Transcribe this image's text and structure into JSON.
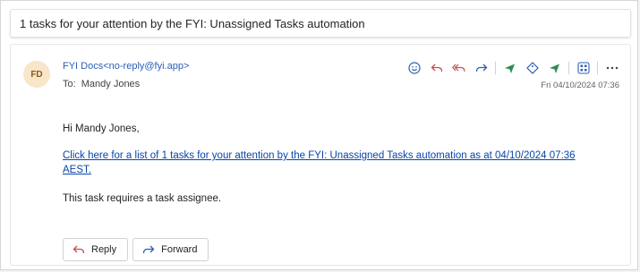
{
  "subject": "1 tasks for your attention by the FYI: Unassigned Tasks automation",
  "message": {
    "avatar_initials": "FD",
    "sender": "FYI Docs<no-reply@fyi.app>",
    "to_label": "To:",
    "to_name": "Mandy Jones",
    "date": "Fri 04/10/2024 07:36",
    "greeting": "Hi Mandy Jones,",
    "link_text": "Click here for a list of 1 tasks for your attention by the FYI: Unassigned Tasks automation as at 04/10/2024 07:36 AEST.",
    "note": "This task requires a task assignee."
  },
  "buttons": {
    "reply": "Reply",
    "forward": "Forward"
  },
  "toolbar_icons": [
    "emoji-icon",
    "reply-icon",
    "reply-all-icon",
    "forward-icon",
    "send-icon",
    "tag-icon",
    "send-icon",
    "apps-icon",
    "more-icon"
  ],
  "colors": {
    "accent_blue": "#2b5fb3",
    "link": "#0645ad",
    "green_action": "#2e8b57",
    "avatar_bg": "#f9e5c8"
  }
}
